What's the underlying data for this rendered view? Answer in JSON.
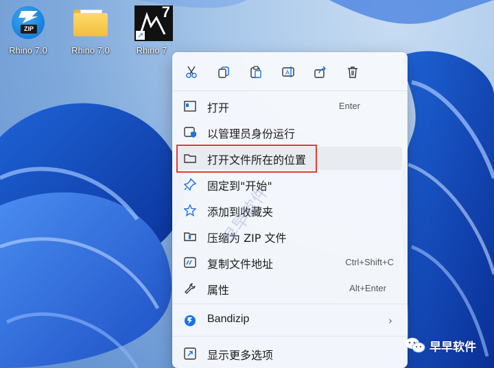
{
  "desktop": {
    "icons": [
      {
        "label": "Rhino 7.0"
      },
      {
        "label": "Rhino 7.0"
      },
      {
        "label": "Rhino 7"
      }
    ]
  },
  "menu": {
    "items": [
      {
        "label": "打开",
        "accel": "Enter"
      },
      {
        "label": "以管理员身份运行",
        "accel": ""
      },
      {
        "label": "打开文件所在的位置",
        "accel": ""
      },
      {
        "label": "固定到\"开始\"",
        "accel": ""
      },
      {
        "label": "添加到收藏夹",
        "accel": ""
      },
      {
        "label": "压缩为 ZIP 文件",
        "accel": ""
      },
      {
        "label": "复制文件地址",
        "accel": "Ctrl+Shift+C"
      },
      {
        "label": "属性",
        "accel": "Alt+Enter"
      },
      {
        "label": "Bandizip",
        "accel": ""
      },
      {
        "label": "显示更多选项",
        "accel": ""
      }
    ]
  },
  "watermark": {
    "text": "早早软件"
  },
  "branding": {
    "wechat_label": "早早软件"
  },
  "colors": {
    "highlight": "#e53935",
    "accent": "#1a73e8"
  }
}
